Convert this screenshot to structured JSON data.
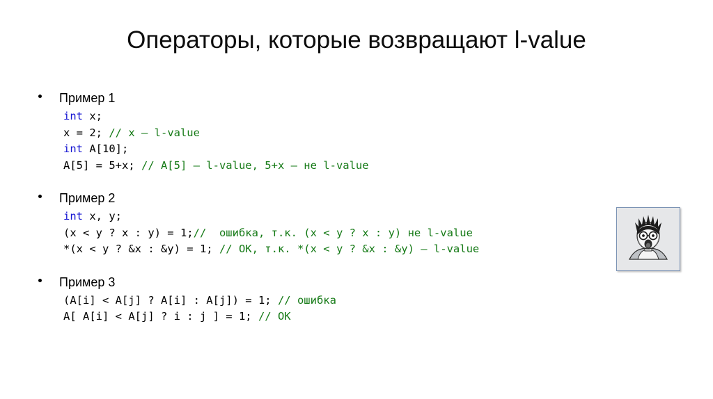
{
  "slide": {
    "title": "Операторы, которые возвращают l-value",
    "bullet_glyph": "•",
    "colors": {
      "keyword": "#1414d2",
      "comment": "#157a16",
      "code": "#000000",
      "title": "#0d0d0d",
      "frame_border": "#7b93b4",
      "frame_background": "#e6e7e9"
    },
    "examples": [
      {
        "heading": "Пример 1",
        "lines": [
          [
            {
              "kind": "keyword",
              "text": "int"
            },
            {
              "kind": "code",
              "text": " x;"
            }
          ],
          [
            {
              "kind": "code",
              "text": "x = 2; "
            },
            {
              "kind": "comment",
              "text": "// x – l-value"
            }
          ],
          [
            {
              "kind": "keyword",
              "text": "int"
            },
            {
              "kind": "code",
              "text": " A[10];"
            }
          ],
          [
            {
              "kind": "code",
              "text": "A[5] = 5+x; "
            },
            {
              "kind": "comment",
              "text": "// A[5] – l-value, 5+x – не l-value"
            }
          ]
        ]
      },
      {
        "heading": "Пример 2",
        "lines": [
          [
            {
              "kind": "keyword",
              "text": "int"
            },
            {
              "kind": "code",
              "text": " x, y;"
            }
          ],
          [
            {
              "kind": "code",
              "text": "(x < y ? x : y) = 1;"
            },
            {
              "kind": "comment",
              "text": "//  ошибка, т.к. (x < y ? x : y) не l-value"
            }
          ],
          [
            {
              "kind": "code",
              "text": "*(x < y ? &x : &y) = 1; "
            },
            {
              "kind": "comment",
              "text": "// OK, т.к. *(x < y ? &x : &y) – l-value"
            }
          ]
        ]
      },
      {
        "heading": "Пример 3",
        "lines": [
          [
            {
              "kind": "code",
              "text": "(A[i] < A[j] ? A[i] : A[j]) = 1; "
            },
            {
              "kind": "comment",
              "text": "// ошибка"
            }
          ],
          [
            {
              "kind": "code",
              "text": "A[ A[i] < A[j] ? i : j ] = 1; "
            },
            {
              "kind": "comment",
              "text": "// OK"
            }
          ]
        ]
      }
    ],
    "picture": {
      "name": "shocked-man-illustration",
      "description": "Shocked man with spiky hair and glasses"
    }
  }
}
